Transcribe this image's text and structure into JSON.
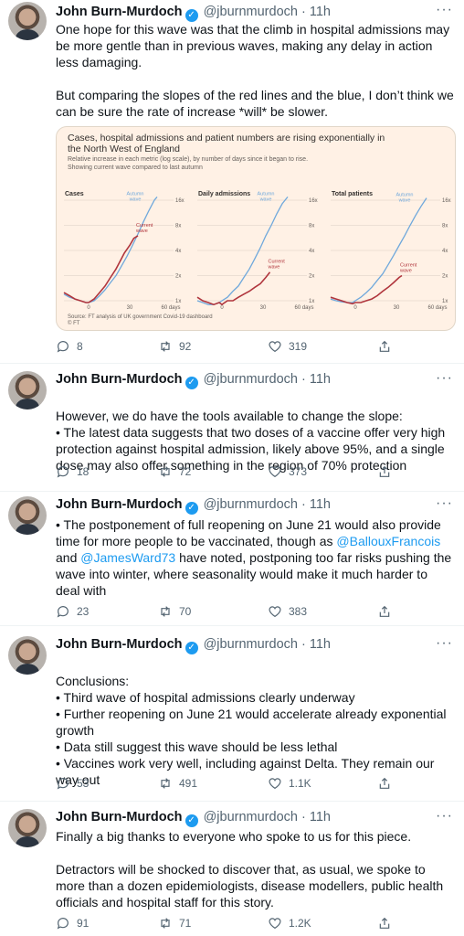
{
  "author": {
    "name": "John Burn-Murdoch",
    "handle": "@jburnmurdoch",
    "time": "11h",
    "verified": true
  },
  "tweets": [
    {
      "paragraphs": [
        "One hope for this wave was that the climb in hospital admissions may be more gentle than in previous waves, making any delay in action less damaging.",
        "But comparing the slopes of the red lines and the blue, I don’t think we can be sure the rate of increase *will* be slower."
      ],
      "replies": "8",
      "retweets": "92",
      "likes": "319"
    },
    {
      "paragraphs": [
        "However, we do have the tools available to change the slope:\n• The latest data suggests that two doses of a vaccine offer very high protection against hospital admission, likely above 95%, and a single dose may also offer something in the region of 70% protection"
      ],
      "replies": "18",
      "retweets": "72",
      "likes": "373"
    },
    {
      "text_before": "• The postponement of full reopening on June 21 would also provide time for more people to be vaccinated, though as ",
      "mention1": "@BallouxFrancois",
      "text_mid": " and ",
      "mention2": "@JamesWard73",
      "text_after": " have noted, postponing too far risks pushing the wave into winter, where seasonality would make it much harder to deal with",
      "replies": "23",
      "retweets": "70",
      "likes": "383"
    },
    {
      "paragraphs": [
        "Conclusions:\n• Third wave of hospital admissions clearly underway\n• Further reopening on June 21 would accelerate already exponential growth\n• Data still suggest this wave should be less lethal\n• Vaccines work very well, including against Delta. They remain our way out"
      ],
      "replies": "53",
      "retweets": "491",
      "likes": "1.1K"
    },
    {
      "paragraphs": [
        "Finally a big thanks to everyone who spoke to us for this piece.",
        "Detractors will be shocked to discover that, as usual, we spoke to more than a dozen epidemiologists, disease modellers, public health officials and hospital staff for this story."
      ],
      "replies": "91",
      "retweets": "71",
      "likes": "1.2K"
    }
  ],
  "colors": {
    "autumn": "#6fa8dc",
    "current": "#b0353d",
    "chart_bg": "#fff1e5",
    "link": "#1d9bf0"
  },
  "chart_data": {
    "type": "line",
    "title": "Cases, hospital admissions and patient numbers are rising exponentially in the North West of England",
    "subtitle": "Relative increase in each metric (log scale), by number of days since it began to rise.\nShowing current wave compared to last autumn",
    "source": "Source: FT analysis of UK government Covid-19 dashboard\n© FT",
    "yscale": "log",
    "ytick_labels": [
      "1x",
      "2x",
      "4x",
      "8x",
      "16x"
    ],
    "yticks": [
      1,
      2,
      4,
      8,
      16
    ],
    "xtick_labels": [
      "0",
      "30",
      "60 days"
    ],
    "xticks": [
      0,
      30,
      60
    ],
    "xlim": [
      -18,
      62
    ],
    "panels": [
      {
        "title": "Cases",
        "series": [
          {
            "name": "Autumn wave",
            "x": [
              -18,
              -14,
              -10,
              -6,
              -2,
              0,
              4,
              8,
              12,
              16,
              20,
              24,
              28,
              32,
              36,
              40,
              44,
              48,
              50
            ],
            "y": [
              1.2,
              1.1,
              1.05,
              1.0,
              0.95,
              0.95,
              1.0,
              1.15,
              1.35,
              1.65,
              2.0,
              2.6,
              3.4,
              4.6,
              6.3,
              8.8,
              12.0,
              16.0,
              17.5
            ]
          },
          {
            "name": "Current wave",
            "x": [
              -18,
              -14,
              -10,
              -6,
              -2,
              0,
              4,
              8,
              12,
              16,
              20,
              24,
              26,
              30,
              33,
              36
            ],
            "y": [
              1.25,
              1.15,
              1.05,
              1.0,
              0.95,
              0.95,
              1.05,
              1.25,
              1.5,
              1.9,
              2.4,
              3.2,
              3.7,
              4.6,
              5.6,
              6.0
            ]
          }
        ]
      },
      {
        "title": "Daily admissions",
        "series": [
          {
            "name": "Autumn wave",
            "x": [
              -18,
              -14,
              -10,
              -6,
              -2,
              0,
              4,
              8,
              12,
              16,
              20,
              24,
              28,
              32,
              36,
              40,
              44,
              48
            ],
            "y": [
              1.0,
              0.95,
              0.9,
              0.9,
              0.95,
              1.0,
              1.1,
              1.3,
              1.5,
              1.9,
              2.4,
              3.2,
              4.3,
              6.0,
              8.0,
              11.0,
              14.5,
              17.5
            ]
          },
          {
            "name": "Current wave",
            "x": [
              -18,
              -14,
              -10,
              -6,
              -2,
              0,
              4,
              8,
              12,
              16,
              20,
              24,
              28,
              32,
              35
            ],
            "y": [
              1.1,
              1.0,
              0.95,
              0.9,
              0.95,
              0.9,
              1.0,
              1.0,
              1.1,
              1.2,
              1.3,
              1.45,
              1.6,
              1.9,
              2.2
            ]
          }
        ]
      },
      {
        "title": "Total patients",
        "series": [
          {
            "name": "Autumn wave",
            "x": [
              -18,
              -14,
              -10,
              -6,
              -2,
              0,
              4,
              8,
              12,
              16,
              20,
              24,
              28,
              32,
              36,
              40,
              44,
              48,
              52
            ],
            "y": [
              1.05,
              1.0,
              0.97,
              0.95,
              0.95,
              1.0,
              1.1,
              1.25,
              1.45,
              1.75,
              2.1,
              2.7,
              3.5,
              4.6,
              6.0,
              8.0,
              10.5,
              13.5,
              17.0
            ]
          },
          {
            "name": "Current wave",
            "x": [
              -18,
              -14,
              -10,
              -6,
              -2,
              0,
              4,
              8,
              12,
              16,
              20,
              24,
              28,
              32,
              34
            ],
            "y": [
              1.1,
              1.05,
              1.0,
              0.95,
              0.92,
              0.95,
              0.95,
              1.0,
              1.05,
              1.15,
              1.3,
              1.45,
              1.65,
              1.9,
              2.0
            ]
          }
        ]
      }
    ]
  }
}
